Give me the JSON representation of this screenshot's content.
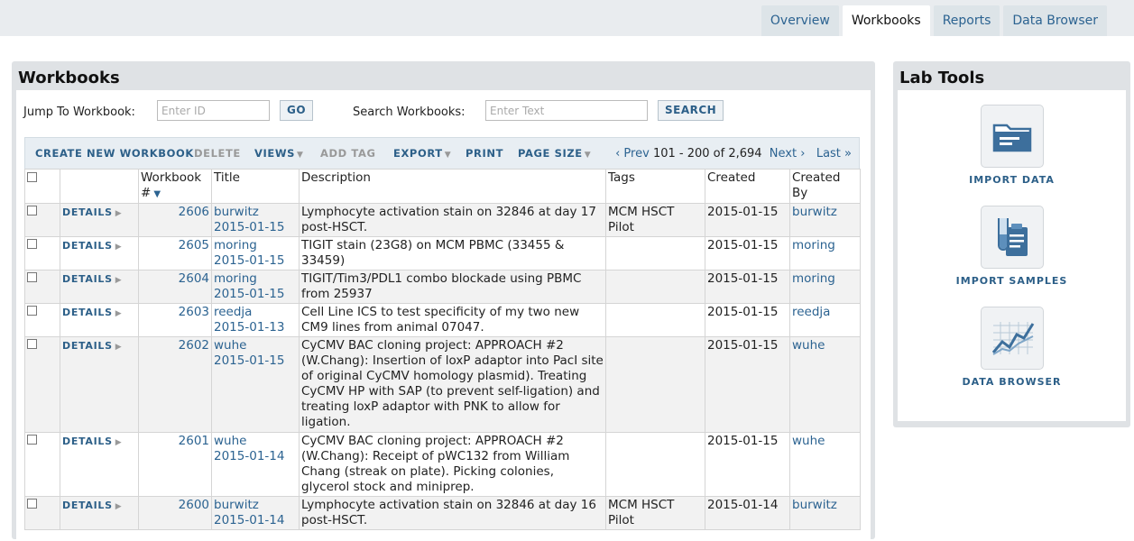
{
  "nav": {
    "tabs": [
      {
        "label": "Overview"
      },
      {
        "label": "Workbooks"
      },
      {
        "label": "Reports"
      },
      {
        "label": "Data Browser"
      }
    ]
  },
  "workbooks": {
    "title": "Workbooks",
    "jump_label": "Jump To Workbook:",
    "jump_placeholder": "Enter ID",
    "go_label": "GO",
    "search_label": "Search Workbooks:",
    "search_placeholder": "Enter Text",
    "search_button": "SEARCH",
    "toolbar": {
      "create": "CREATE NEW WORKBOOK",
      "delete": "DELETE",
      "views": "VIEWS",
      "add_tag": "ADD TAG",
      "export": "EXPORT",
      "print": "PRINT",
      "page_size": "PAGE SIZE"
    },
    "pager": {
      "prev": "‹ Prev",
      "range": "101 - 200 of 2,694",
      "next": "Next ›",
      "last": "Last »"
    },
    "columns": {
      "workbook": "Workbook #",
      "title": "Title",
      "description": "Description",
      "tags": "Tags",
      "created": "Created",
      "created_by": "Created By"
    },
    "details_label": "DETAILS",
    "rows": [
      {
        "id": "2606",
        "title_user": "burwitz",
        "title_date": "2015-01-15",
        "description": "Lymphocyte activation stain on 32846 at day 17 post-HSCT.",
        "tags": "MCM HSCT Pilot",
        "created": "2015-01-15",
        "created_by": "burwitz"
      },
      {
        "id": "2605",
        "title_user": "moring",
        "title_date": "2015-01-15",
        "description": "TIGIT stain (23G8) on MCM PBMC (33455 & 33459)",
        "tags": "",
        "created": "2015-01-15",
        "created_by": "moring"
      },
      {
        "id": "2604",
        "title_user": "moring",
        "title_date": "2015-01-15",
        "description": "TIGIT/Tim3/PDL1 combo blockade using PBMC from 25937",
        "tags": "",
        "created": "2015-01-15",
        "created_by": "moring"
      },
      {
        "id": "2603",
        "title_user": "reedja",
        "title_date": "2015-01-13",
        "description": "Cell Line ICS to test specificity of my two new CM9 lines from animal 07047.",
        "tags": "",
        "created": "2015-01-15",
        "created_by": "reedja"
      },
      {
        "id": "2602",
        "title_user": "wuhe",
        "title_date": "2015-01-15",
        "description": "CyCMV BAC cloning project: APPROACH #2 (W.Chang): Insertion of loxP adaptor into PacI site of original CyCMV homology plasmid). Treating CyCMV HP with SAP (to prevent self-ligation) and treating loxP adaptor with PNK to allow for ligation.",
        "tags": "",
        "created": "2015-01-15",
        "created_by": "wuhe"
      },
      {
        "id": "2601",
        "title_user": "wuhe",
        "title_date": "2015-01-14",
        "description": "CyCMV BAC cloning project: APPROACH #2 (W.Chang): Receipt of pWC132 from William Chang (streak on plate). Picking colonies, glycerol stock and miniprep.",
        "tags": "",
        "created": "2015-01-15",
        "created_by": "wuhe"
      },
      {
        "id": "2600",
        "title_user": "burwitz",
        "title_date": "2015-01-14",
        "description": "Lymphocyte activation stain on 32846 at day 16 post-HSCT.",
        "tags": "MCM HSCT Pilot",
        "created": "2015-01-14",
        "created_by": "burwitz"
      }
    ]
  },
  "lab_tools": {
    "title": "Lab Tools",
    "tools": [
      {
        "label": "IMPORT DATA",
        "icon": "folder-icon"
      },
      {
        "label": "IMPORT SAMPLES",
        "icon": "test-tube-clipboard-icon"
      },
      {
        "label": "DATA BROWSER",
        "icon": "line-chart-icon"
      }
    ]
  },
  "colors": {
    "link": "#2c6391",
    "panel_bg": "#dfe2e5",
    "topbar_bg": "#e9ecef"
  }
}
